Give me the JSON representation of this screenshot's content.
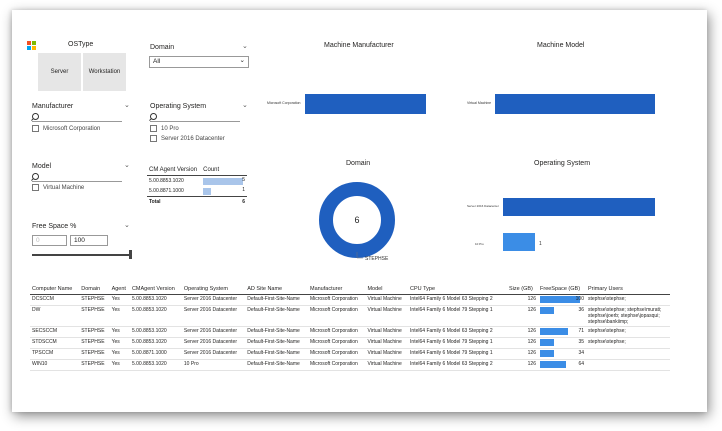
{
  "ostype": {
    "title": "OSType",
    "buttons": [
      "Server",
      "Workstation"
    ]
  },
  "domain_slicer": {
    "title": "Domain",
    "selected": "All"
  },
  "manufacturer_slicer": {
    "title": "Manufacturer",
    "items": [
      "Microsoft Corporation"
    ]
  },
  "os_slicer": {
    "title": "Operating System",
    "items": [
      "10 Pro",
      "Server 2016 Datacenter"
    ]
  },
  "model_slicer": {
    "title": "Model",
    "items": [
      "Virtual Machine"
    ]
  },
  "agent_table": {
    "headers": [
      "CM Agent Version",
      "Count"
    ],
    "rows": [
      {
        "version": "5.00.8853.1020",
        "count": "5"
      },
      {
        "version": "5.00.8871.1000",
        "count": "1"
      }
    ],
    "total_label": "Total",
    "total": "6"
  },
  "freespace_slicer": {
    "title": "Free Space %",
    "min_placeholder": "0",
    "max_value": "100"
  },
  "charts": {
    "manufacturer": {
      "title": "Machine Manufacturer"
    },
    "model": {
      "title": "Machine Model"
    },
    "domain": {
      "title": "Domain",
      "center": "6",
      "legend": "STEPHSE"
    },
    "os": {
      "title": "Operating System",
      "value_label": "1"
    }
  },
  "chart_data": [
    {
      "type": "bar",
      "title": "Machine Manufacturer",
      "categories": [
        "Microsoft Corporation"
      ],
      "values": [
        6
      ]
    },
    {
      "type": "bar",
      "title": "Machine Model",
      "categories": [
        "Virtual Machine"
      ],
      "values": [
        6
      ]
    },
    {
      "type": "pie",
      "title": "Domain",
      "categories": [
        "STEPHSE"
      ],
      "values": [
        6
      ]
    },
    {
      "type": "bar",
      "title": "Operating System",
      "categories": [
        "Server 2016 Datacenter",
        "10 Pro"
      ],
      "values": [
        5,
        1
      ]
    }
  ],
  "grid": {
    "headers": [
      "Computer Name",
      "Domain",
      "Agent",
      "CMAgent Version",
      "Operating System",
      "AD Site Name",
      "Manufacturer",
      "Model",
      "CPU Type",
      "Size (GB)",
      "FreeSpace (GB)",
      "Primary Users"
    ],
    "rows": [
      {
        "name": "DCSCCM",
        "domain": "STEPHSE",
        "agent": "Yes",
        "ver": "5.00.8853.1020",
        "os": "Server 2016 Datacenter",
        "site": "Default-First-Site-Name",
        "man": "Microsoft Corporation",
        "model": "Virtual Machine",
        "cpu": "Intel64 Family 6 Model 63 Stepping 2",
        "size": "126",
        "free": "100",
        "free_frac": 1.0,
        "users": "stephse\\stephse;"
      },
      {
        "name": "DW",
        "domain": "STEPHSE",
        "agent": "Yes",
        "ver": "5.00.8853.1020",
        "os": "Server 2016 Datacenter",
        "site": "Default-First-Site-Name",
        "man": "Microsoft Corporation",
        "model": "Virtual Machine",
        "cpu": "Intel64 Family 6 Model 79 Stepping 1",
        "size": "126",
        "free": "36",
        "free_frac": 0.36,
        "users": "stephse\\stephse; stephse\\murati; stephse\\joerb; stephse\\jopasqui; stephse\\bankiimp;"
      },
      {
        "name": "SECSCCM",
        "domain": "STEPHSE",
        "agent": "Yes",
        "ver": "5.00.8853.1020",
        "os": "Server 2016 Datacenter",
        "site": "Default-First-Site-Name",
        "man": "Microsoft Corporation",
        "model": "Virtual Machine",
        "cpu": "Intel64 Family 6 Model 63 Stepping 2",
        "size": "126",
        "free": "71",
        "free_frac": 0.71,
        "users": "stephse\\stephse;"
      },
      {
        "name": "STDSCCM",
        "domain": "STEPHSE",
        "agent": "Yes",
        "ver": "5.00.8853.1020",
        "os": "Server 2016 Datacenter",
        "site": "Default-First-Site-Name",
        "man": "Microsoft Corporation",
        "model": "Virtual Machine",
        "cpu": "Intel64 Family 6 Model 79 Stepping 1",
        "size": "126",
        "free": "35",
        "free_frac": 0.35,
        "users": "stephse\\stephse;"
      },
      {
        "name": "TPSCCM",
        "domain": "STEPHSE",
        "agent": "Yes",
        "ver": "5.00.8871.1000",
        "os": "Server 2016 Datacenter",
        "site": "Default-First-Site-Name",
        "man": "Microsoft Corporation",
        "model": "Virtual Machine",
        "cpu": "Intel64 Family 6 Model 79 Stepping 1",
        "size": "126",
        "free": "34",
        "free_frac": 0.34,
        "users": ""
      },
      {
        "name": "WIN10",
        "domain": "STEPHSE",
        "agent": "Yes",
        "ver": "5.00.8853.1020",
        "os": "10 Pro",
        "site": "Default-First-Site-Name",
        "man": "Microsoft Corporation",
        "model": "Virtual Machine",
        "cpu": "Intel64 Family 6 Model 63 Stepping 2",
        "size": "126",
        "free": "64",
        "free_frac": 0.64,
        "users": ""
      }
    ]
  },
  "colors": {
    "bar": "#1f5fbf",
    "bar_light": "#3b8de6",
    "selected": "#e6e6e6"
  }
}
